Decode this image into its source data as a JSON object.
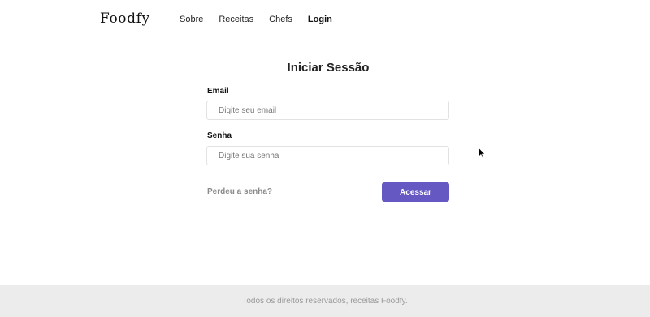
{
  "header": {
    "logo": "Foodfy",
    "nav": [
      {
        "label": "Sobre"
      },
      {
        "label": "Receitas"
      },
      {
        "label": "Chefs"
      },
      {
        "label": "Login",
        "active": true
      }
    ]
  },
  "login": {
    "title": "Iniciar Sessão",
    "email_label": "Email",
    "email_placeholder": "Digite seu email",
    "password_label": "Senha",
    "password_placeholder": "Digite sua senha",
    "forgot_link": "Perdeu a senha?",
    "submit_label": "Acessar"
  },
  "footer": {
    "text": "Todos os direitos reservados, receitas Foodfy."
  },
  "colors": {
    "accent": "#6558c3",
    "footer_bg": "#ececec",
    "muted_text": "#8a8a8a"
  },
  "icons": {
    "cursor": "mouse-pointer-icon"
  }
}
